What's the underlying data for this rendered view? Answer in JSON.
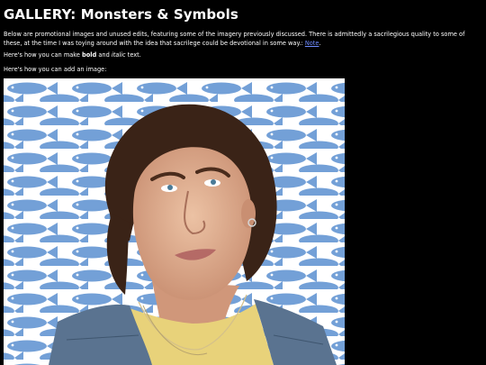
{
  "page": {
    "title": "GALLERY: Monsters & Symbols",
    "intro_text": "Below are promotional images and unused edits, featuring some of the imagery previously discussed. There is admittedly a sacrilegious quality to some of these, at the time I was toying around with the idea that sacrilege could be devotional in some way.: ",
    "intro_link": "Note",
    "intro_end": ".",
    "bold_line": {
      "prefix": "Here's how you can make ",
      "bold": "bold",
      "middle": " and ",
      "italic": "italic",
      "suffix": " text."
    },
    "image_line": "Here's how you can add an image:"
  },
  "photo": {
    "alt": "Young man with curly hair looking upward in front of a blue fish-patterned wall",
    "background_color": "#ffffff",
    "fish_color": "#5a8fd0",
    "hair_color": "#3a2317",
    "skin_color": "#d9a889",
    "vest_color": "#5a7390",
    "shirt_color": "#e8d27a"
  },
  "colors": {
    "background": "#000000",
    "text": "#ffffff",
    "link": "#6f8cff"
  }
}
